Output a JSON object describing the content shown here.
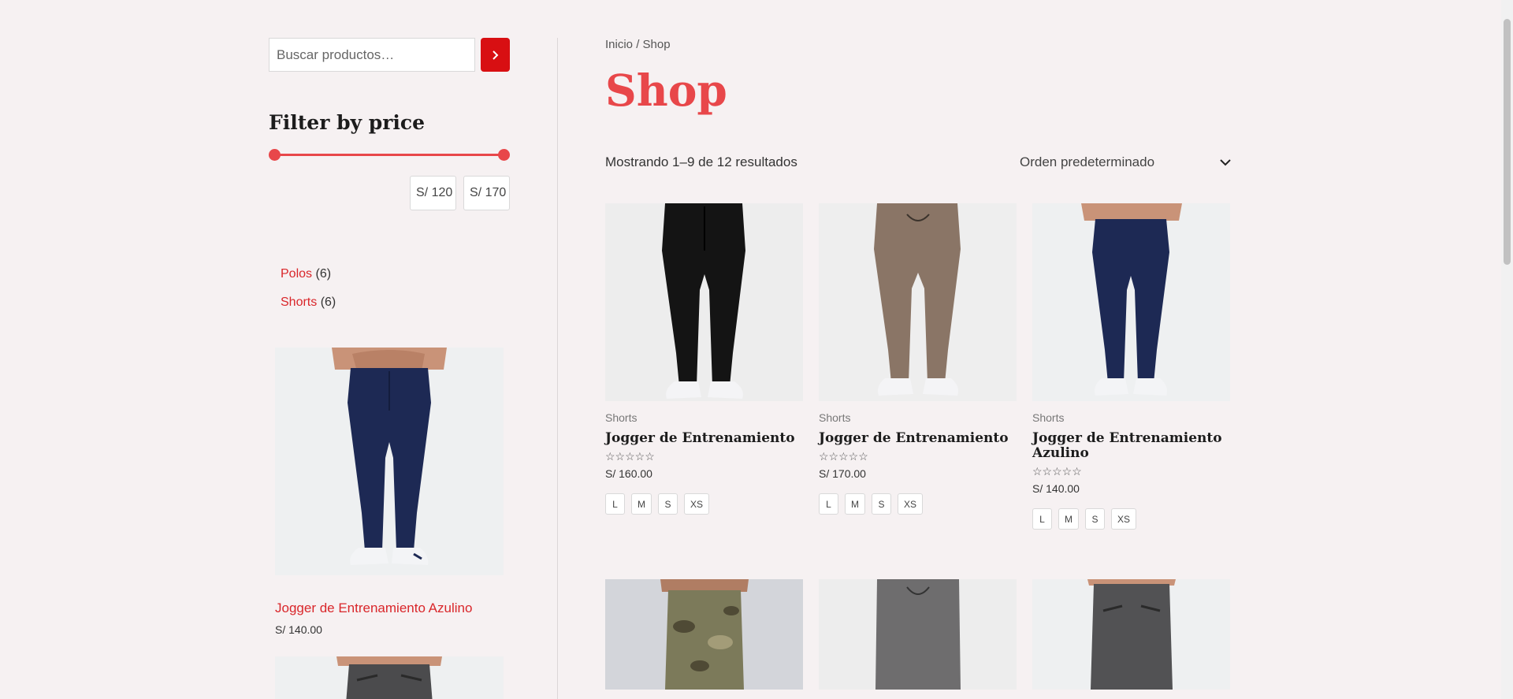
{
  "search": {
    "placeholder": "Buscar productos…"
  },
  "filter": {
    "title": "Filter by price",
    "min_label": "S/ 120",
    "max_label": "S/ 170",
    "range_min": 120,
    "range_max": 170
  },
  "categories": [
    {
      "name": "Polos",
      "count": "(6)"
    },
    {
      "name": "Shorts",
      "count": "(6)"
    }
  ],
  "sidebar_product": {
    "name": "Jogger de Entrenamiento Azulino",
    "price": "S/ 140.00"
  },
  "breadcrumb": {
    "home": "Inicio",
    "sep": " / ",
    "current": "Shop"
  },
  "page_title": "Shop",
  "result_count": "Mostrando 1–9 de 12 resultados",
  "orderby": "Orden predeterminado",
  "products": [
    {
      "category": "Shorts",
      "title": "Jogger de Entrenamiento",
      "stars": "☆☆☆☆☆",
      "price": "S/ 160.00",
      "sizes": [
        "L",
        "M",
        "S",
        "XS"
      ],
      "pants_color": "#141414"
    },
    {
      "category": "Shorts",
      "title": "Jogger de Entrenamiento",
      "stars": "☆☆☆☆☆",
      "price": "S/ 170.00",
      "sizes": [
        "L",
        "M",
        "S",
        "XS"
      ],
      "pants_color": "#8a7566"
    },
    {
      "category": "Shorts",
      "title": "Jogger de Entrenamiento Azulino",
      "stars": "☆☆☆☆☆",
      "price": "S/ 140.00",
      "sizes": [
        "L",
        "M",
        "S",
        "XS"
      ],
      "pants_color": "#1d2954"
    }
  ],
  "colors": {
    "accent": "#e8474a",
    "button": "#d80f12",
    "link": "#d9262a",
    "background": "#f6f1f2"
  }
}
